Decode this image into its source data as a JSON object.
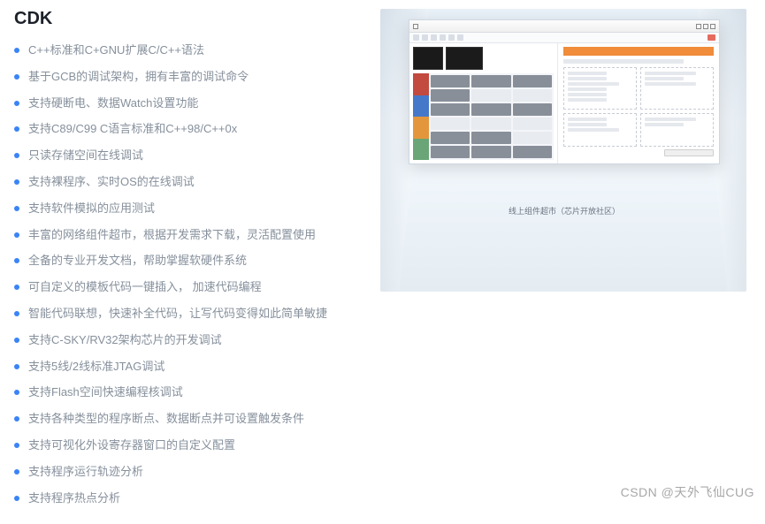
{
  "title": "CDK",
  "features": [
    "C++标准和C+GNU扩展C/C++语法",
    "基于GCB的调试架构，拥有丰富的调试命令",
    "支持硬断电、数据Watch设置功能",
    "支持C89/C99 C语言标准和C++98/C++0x",
    "只读存储空间在线调试",
    "支持裸程序、实时OS的在线调试",
    "支持软件模拟的应用测试",
    "丰富的网络组件超市，根据开发需求下载，灵活配置使用",
    "全备的专业开发文档，帮助掌握软硬件系统",
    "可自定义的模板代码一键插入， 加速代码编程",
    "智能代码联想，快速补全代码，让写代码变得如此简单敏捷",
    "支持C-SKY/RV32架构芯片的开发调试",
    "支持5线/2线标准JTAG调试",
    "支持Flash空间快速编程核调试",
    "支持各种类型的程序断点、数据断点并可设置触发条件",
    "支持可视化外设寄存器窗口的自定义配置",
    "支持程序运行轨迹分析",
    "支持程序热点分析"
  ],
  "screenshot": {
    "caption": "线上组件超市（芯片开放社区）"
  },
  "watermark": "CSDN @天外飞仙CUG"
}
